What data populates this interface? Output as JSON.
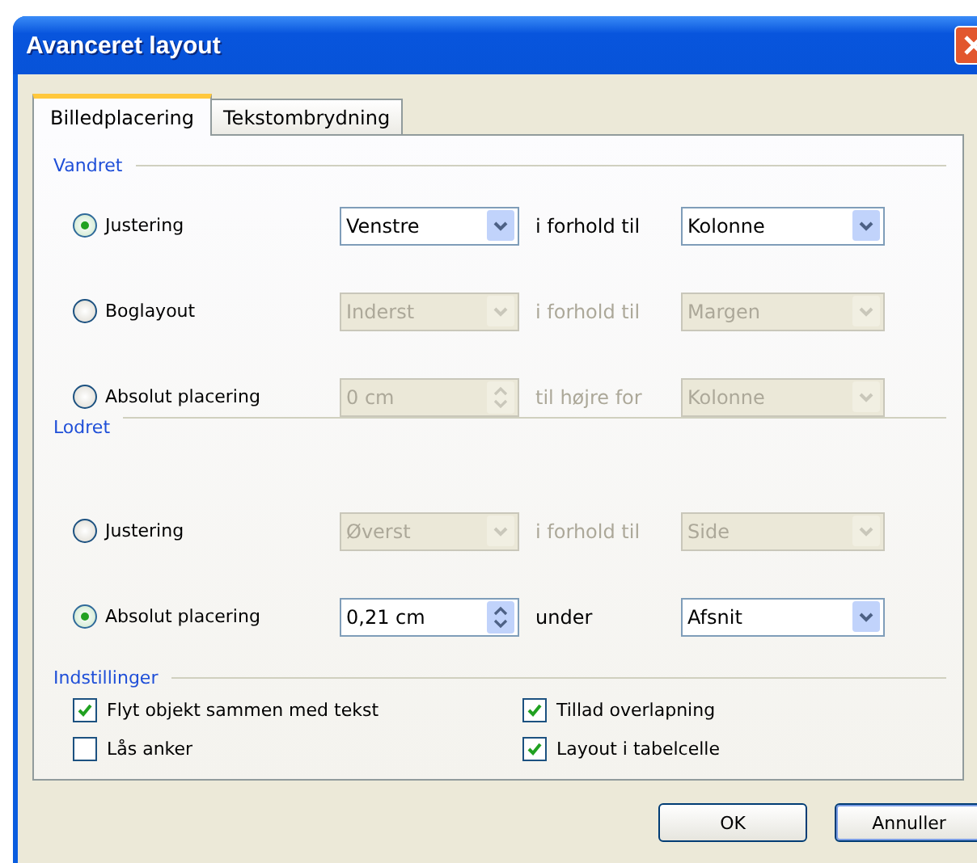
{
  "window": {
    "title": "Avanceret layout"
  },
  "tabs": [
    {
      "label": "Billedplacering",
      "selected": true
    },
    {
      "label": "Tekstombrydning",
      "selected": false
    }
  ],
  "sections": [
    {
      "heading": "Vandret",
      "rows": [
        {
          "label": "Justering",
          "selected": true,
          "disabled": false,
          "field": {
            "kind": "dropdown",
            "value": "Venstre"
          },
          "relation": "i forhold til",
          "target": "Kolonne"
        },
        {
          "label": "Boglayout",
          "selected": false,
          "disabled": true,
          "field": {
            "kind": "dropdown",
            "value": "Inderst"
          },
          "relation": "i forhold til",
          "target": "Margen"
        },
        {
          "label": "Absolut placering",
          "selected": false,
          "disabled": true,
          "field": {
            "kind": "spinner",
            "value": "0 cm"
          },
          "relation": "til højre for",
          "target": "Kolonne"
        }
      ]
    },
    {
      "heading": "Lodret",
      "rows": [
        {
          "label": "Justering",
          "selected": false,
          "disabled": true,
          "field": {
            "kind": "dropdown",
            "value": "Øverst"
          },
          "relation": "i forhold til",
          "target": "Side"
        },
        {
          "label": "Absolut placering",
          "selected": true,
          "disabled": false,
          "field": {
            "kind": "spinner",
            "value": "0,21 cm"
          },
          "relation": "under",
          "target": "Afsnit"
        }
      ]
    }
  ],
  "settings": {
    "heading": "Indstillinger",
    "options": [
      {
        "label": "Flyt objekt sammen med tekst",
        "checked": true
      },
      {
        "label": "Tillad overlapning",
        "checked": true
      },
      {
        "label": "Lås anker",
        "checked": false
      },
      {
        "label": "Layout i tabelcelle",
        "checked": true
      }
    ]
  },
  "buttons": [
    {
      "label": "OK"
    },
    {
      "label": "Annuller"
    }
  ]
}
